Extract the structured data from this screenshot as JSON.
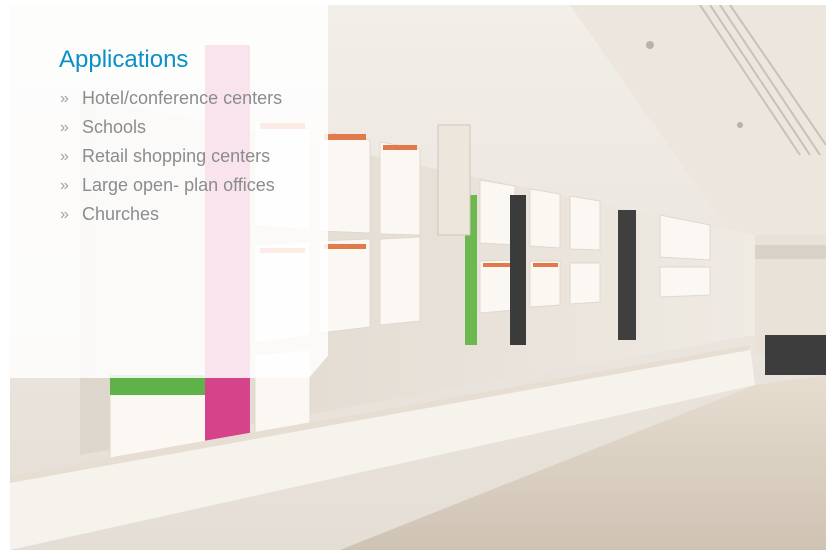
{
  "panel": {
    "heading": "Applications",
    "bullet_glyph": "»",
    "items": [
      "Hotel/conference centers",
      "Schools",
      "Retail shopping centers",
      "Large open- plan offices",
      "Churches"
    ]
  },
  "colors": {
    "heading": "#0a8fc9",
    "item_text": "#8a8c8e",
    "overlay": "#ffffff"
  },
  "photo": {
    "subject": "eyewear-retail-store-display-wall"
  }
}
